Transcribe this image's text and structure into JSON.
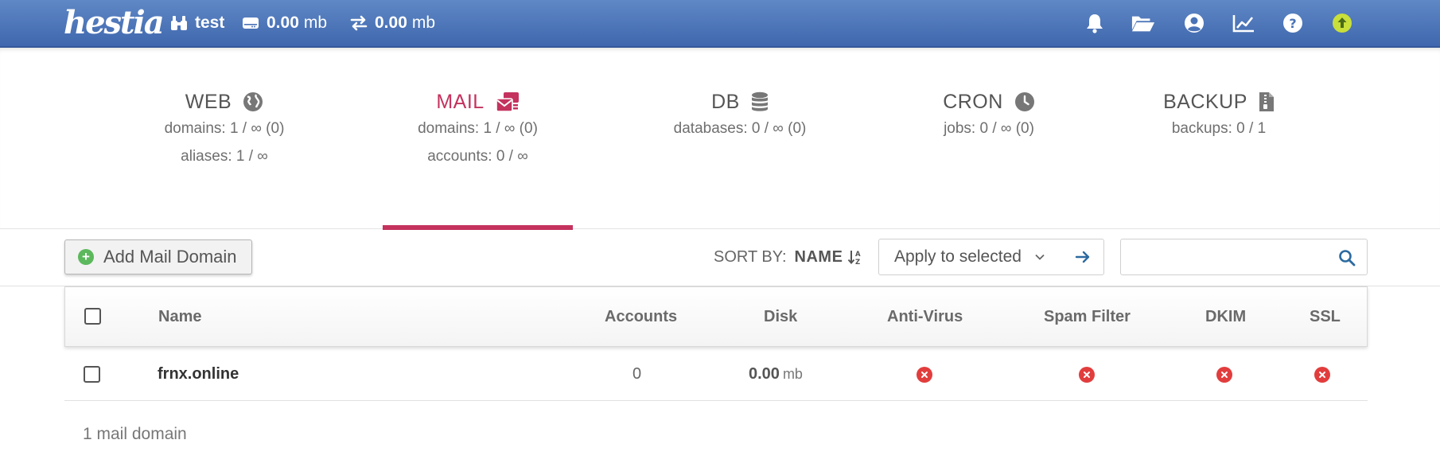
{
  "topbar": {
    "logo": "hestia",
    "user": "test",
    "disk_value": "0.00",
    "disk_unit": "mb",
    "bandwidth_value": "0.00",
    "bandwidth_unit": "mb",
    "icons": [
      "bell-icon",
      "folder-open-icon",
      "user-circle-icon",
      "chart-line-icon",
      "help-icon",
      "update-icon"
    ]
  },
  "tabs": [
    {
      "name": "WEB",
      "icon": "globe-icon",
      "lines": [
        "domains: 1 / ∞ (0)",
        "aliases: 1 / ∞"
      ]
    },
    {
      "name": "MAIL",
      "icon": "mail-bulk-icon",
      "lines": [
        "domains: 1 / ∞ (0)",
        "accounts: 0 / ∞"
      ],
      "active": true
    },
    {
      "name": "DB",
      "icon": "database-icon",
      "lines": [
        "databases: 0 / ∞ (0)"
      ]
    },
    {
      "name": "CRON",
      "icon": "clock-icon",
      "lines": [
        "jobs: 0 / ∞ (0)"
      ]
    },
    {
      "name": "BACKUP",
      "icon": "file-archive-icon",
      "lines": [
        "backups: 0 / 1"
      ]
    }
  ],
  "toolbar": {
    "add_label": "Add Mail Domain",
    "sort_label": "SORT BY:",
    "sort_value": "NAME",
    "bulk_select": "Apply to selected",
    "search_placeholder": ""
  },
  "table": {
    "headers": [
      "Name",
      "Accounts",
      "Disk",
      "Anti-Virus",
      "Spam Filter",
      "DKIM",
      "SSL"
    ],
    "rows": [
      {
        "name": "frnx.online",
        "accounts": "0",
        "disk_value": "0.00",
        "disk_unit": "mb",
        "antivirus": "disabled",
        "spam_filter": "disabled",
        "dkim": "disabled",
        "ssl": "disabled"
      }
    ]
  },
  "footer": {
    "count_text": "1 mail domain"
  },
  "colors": {
    "topbar": "#4a72b6",
    "accent": "#c4325e",
    "status_bad": "#e23d3d",
    "add_icon": "#5cb85c",
    "link": "#2c6aa0"
  }
}
